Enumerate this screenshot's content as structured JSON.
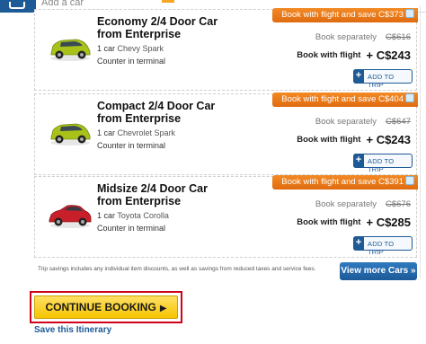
{
  "header": {
    "tab_icon": "car-icon",
    "visible_text": "Add a car"
  },
  "cars": [
    {
      "name": "Economy 2/4 Door Car from Enterprise",
      "count": "1 car",
      "model": "Chevy Spark",
      "pickup": "Counter in terminal",
      "promo_text": "Book with flight and save",
      "promo_amount": "C$373",
      "separately_label": "Book separately",
      "separately_price": "C$616",
      "flight_label": "Book with flight",
      "flight_price": "+ C$243",
      "add_label": "ADD TO TRIP",
      "color": "#a8c21a"
    },
    {
      "name": "Compact 2/4 Door Car from Enterprise",
      "count": "1 car",
      "model": "Chevrolet Spark",
      "pickup": "Counter in terminal",
      "promo_text": "Book with flight and save",
      "promo_amount": "C$404",
      "separately_label": "Book separately",
      "separately_price": "C$647",
      "flight_label": "Book with flight",
      "flight_price": "+ C$243",
      "add_label": "ADD TO TRIP",
      "color": "#a8c21a"
    },
    {
      "name": "Midsize 2/4 Door Car from Enterprise",
      "count": "1 car",
      "model": "Toyota Corolla",
      "pickup": "Counter in terminal",
      "promo_text": "Book with flight and save",
      "promo_amount": "C$391",
      "separately_label": "Book separately",
      "separately_price": "C$676",
      "flight_label": "Book with flight",
      "flight_price": "+ C$285",
      "add_label": "ADD TO TRIP",
      "color": "#c8202a"
    }
  ],
  "disclaimer": "Trip savings includes any individual item discounts, as well as savings from reduced taxes and service fees.",
  "more_cars_label": "View more Cars",
  "more_cars_icon": "double-chevron-right-icon",
  "continue_label": "CONTINUE BOOKING",
  "continue_icon": "play-arrow-icon",
  "save_itinerary": "Save this Itinerary",
  "colors": {
    "brand_blue": "#1e5a96",
    "promo_orange": "#f08a24",
    "cta_yellow": "#f6c500",
    "highlight_red": "#d0021b"
  }
}
